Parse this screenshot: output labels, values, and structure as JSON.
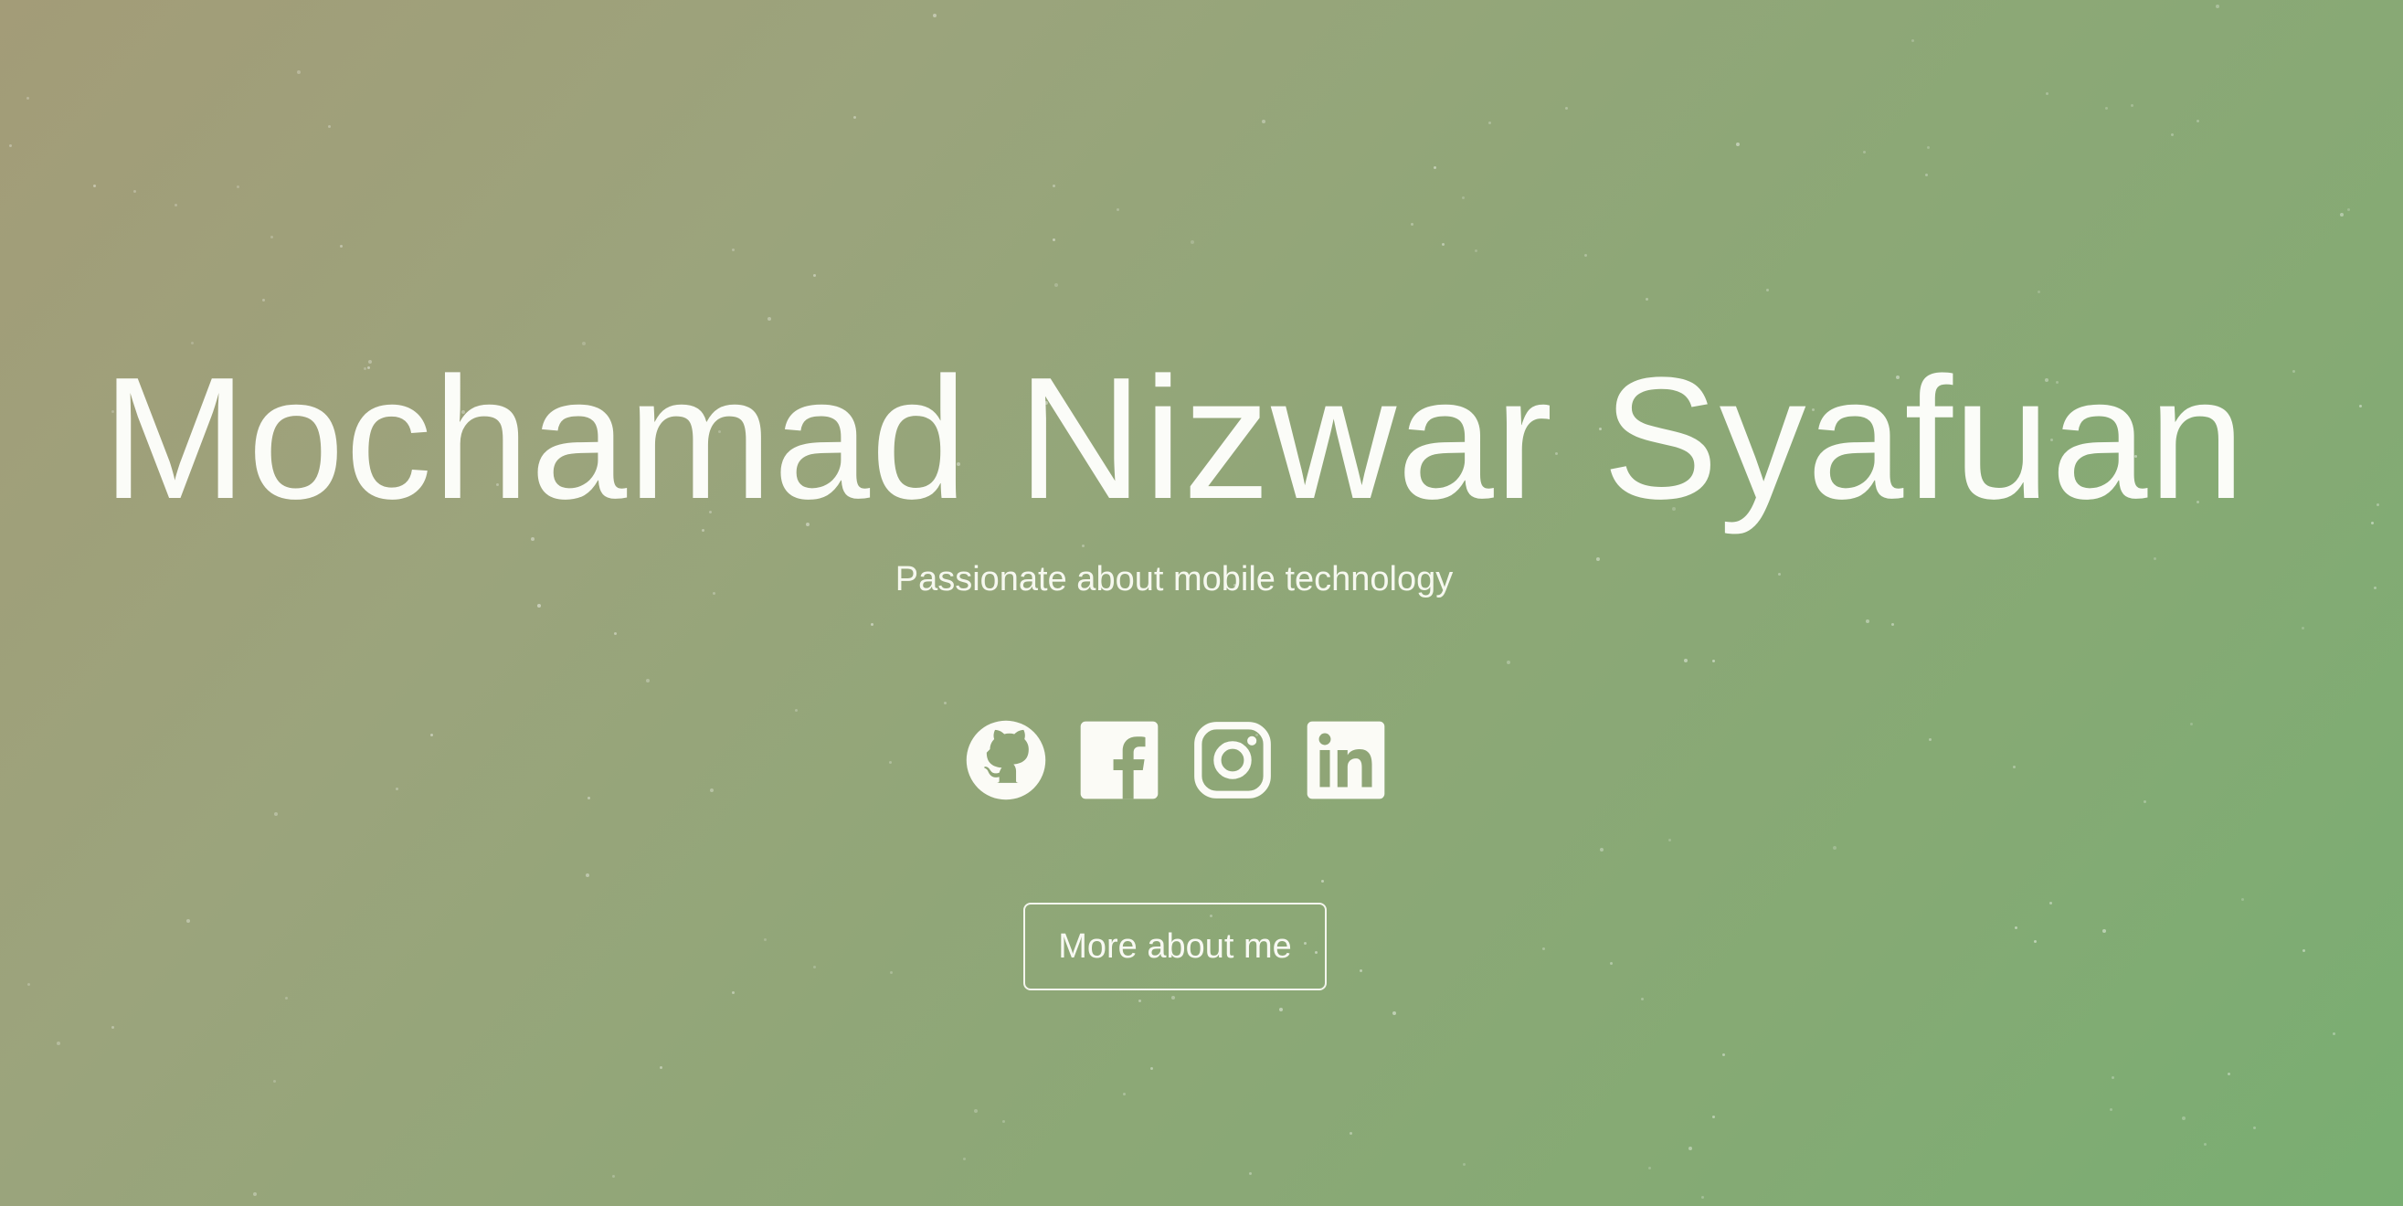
{
  "hero": {
    "name": "Mochamad Nizwar Syafuan",
    "tagline": "Passionate about mobile technology",
    "cta_label": "More about me"
  },
  "social": [
    {
      "icon": "github-icon"
    },
    {
      "icon": "facebook-icon"
    },
    {
      "icon": "instagram-icon"
    },
    {
      "icon": "linkedin-icon"
    }
  ],
  "colors": {
    "gradient_start": "#a39c78",
    "gradient_end": "#79ae72",
    "text": "#fbfcf8"
  }
}
